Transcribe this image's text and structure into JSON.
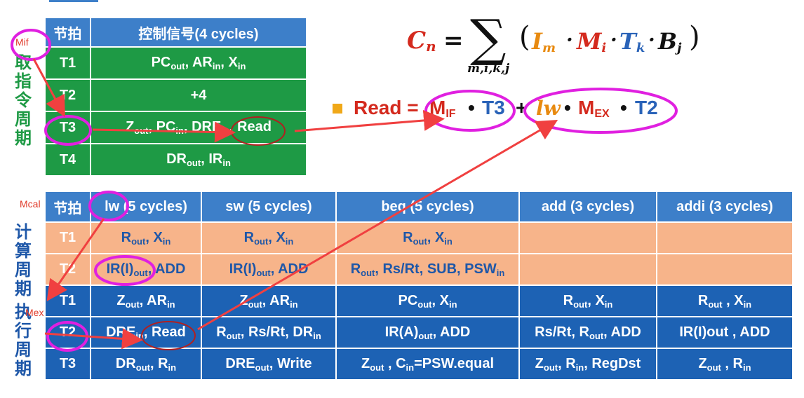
{
  "fetch": {
    "header": [
      "节拍",
      "控制信号(4 cycles)"
    ],
    "rows": [
      {
        "step": "T1",
        "signals": "PC<sub>out</sub>, AR<sub>in</sub>, X<sub>in</sub>"
      },
      {
        "step": "T2",
        "signals": "+4"
      },
      {
        "step": "T3",
        "signals": "Z<sub>out</sub>, PC<sub>in</sub>, DRE<sub>in</sub>, Read"
      },
      {
        "step": "T4",
        "signals": "DR<sub>out</sub>, IR<sub>in</sub>"
      }
    ],
    "side_label": "取指令周期"
  },
  "annotations": {
    "mif": "Mif",
    "mcal": "Mcal",
    "mex": "Mex"
  },
  "formula": {
    "lhs": "C",
    "lhs_sub": "n",
    "sum_sub": "m,i,k,j",
    "terms": [
      "I",
      "M",
      "T",
      "B"
    ],
    "term_subs": [
      "m",
      "i",
      "k",
      "j"
    ]
  },
  "read_eq": {
    "label": "Read =",
    "t1_m": "M",
    "t1_sub": "IF",
    "t1_t": "T3",
    "plus": "+",
    "t2_lw": "lw",
    "t2_m": "M",
    "t2_sub": "EX",
    "t2_t": "T2",
    "dot": "•"
  },
  "exec": {
    "header": [
      "节拍",
      "lw (5 cycles)",
      "sw (5 cycles)",
      "beq (5 cycles)",
      "add (3 cycles)",
      "addi  (3 cycles)"
    ],
    "calc_label": "计算周期",
    "exec_label": "执行周期",
    "calc_rows": [
      {
        "step": "T1",
        "cells": [
          "R<sub>out</sub>, X<sub>in</sub>",
          "R<sub>out</sub>, X<sub>in</sub>",
          "R<sub>out</sub>, X<sub>in</sub>",
          "",
          ""
        ]
      },
      {
        "step": "T2",
        "cells": [
          "IR(I)<sub>out</sub>, ADD",
          "IR(I)<sub>out</sub>, ADD",
          "R<sub>out</sub>, Rs/Rt, SUB, PSW<sub>in</sub>",
          "",
          ""
        ]
      }
    ],
    "exec_rows": [
      {
        "step": "T1",
        "cells": [
          "Z<sub>out</sub>, AR<sub>in</sub>",
          "Z<sub>out</sub>, AR<sub>in</sub>",
          "PC<sub>out</sub>, X<sub>in</sub>",
          "R<sub>out</sub>, X<sub>in</sub>",
          "R<sub>out</sub> , X<sub>in</sub>"
        ]
      },
      {
        "step": "T2",
        "cells": [
          "DRE<sub>in</sub>, Read",
          "R<sub>out</sub>, Rs/Rt, DR<sub>in</sub>",
          "IR(A)<sub>out</sub>, ADD",
          "Rs/Rt, R<sub>out</sub>, ADD",
          "IR(I)out , ADD"
        ]
      },
      {
        "step": "T3",
        "cells": [
          "DR<sub>out</sub>, R<sub>in</sub>",
          "DRE<sub>out</sub>, Write",
          "Z<sub>out</sub> , C<sub>in</sub>=PSW.equal",
          "Z<sub>out</sub>, R<sub>in</sub>, RegDst",
          "Z<sub>out</sub> , R<sub>in</sub>"
        ]
      }
    ]
  },
  "colors": {
    "green": "#1e9a45",
    "header_blue": "#3d7fc9",
    "orange": "#f7b48a",
    "dark_blue": "#1d62b4",
    "highlight": "#e020e0",
    "arrow": "#f04040"
  }
}
